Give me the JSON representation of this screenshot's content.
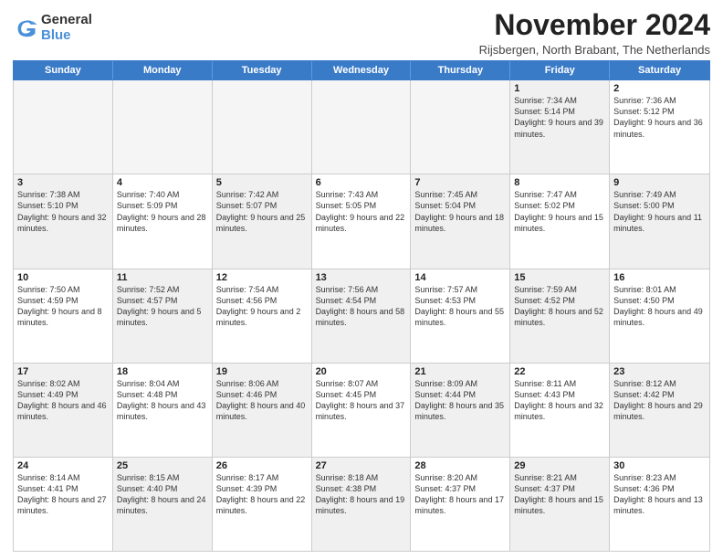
{
  "logo": {
    "general": "General",
    "blue": "Blue"
  },
  "title": "November 2024",
  "location": "Rijsbergen, North Brabant, The Netherlands",
  "days_of_week": [
    "Sunday",
    "Monday",
    "Tuesday",
    "Wednesday",
    "Thursday",
    "Friday",
    "Saturday"
  ],
  "weeks": [
    [
      {
        "day": "",
        "empty": true
      },
      {
        "day": "",
        "empty": true
      },
      {
        "day": "",
        "empty": true
      },
      {
        "day": "",
        "empty": true
      },
      {
        "day": "",
        "empty": true
      },
      {
        "day": "1",
        "info": "Sunrise: 7:34 AM\nSunset: 5:14 PM\nDaylight: 9 hours\nand 39 minutes.",
        "shaded": true
      },
      {
        "day": "2",
        "info": "Sunrise: 7:36 AM\nSunset: 5:12 PM\nDaylight: 9 hours\nand 36 minutes.",
        "shaded": false
      }
    ],
    [
      {
        "day": "3",
        "info": "Sunrise: 7:38 AM\nSunset: 5:10 PM\nDaylight: 9 hours\nand 32 minutes.",
        "shaded": true
      },
      {
        "day": "4",
        "info": "Sunrise: 7:40 AM\nSunset: 5:09 PM\nDaylight: 9 hours\nand 28 minutes.",
        "shaded": false
      },
      {
        "day": "5",
        "info": "Sunrise: 7:42 AM\nSunset: 5:07 PM\nDaylight: 9 hours\nand 25 minutes.",
        "shaded": true
      },
      {
        "day": "6",
        "info": "Sunrise: 7:43 AM\nSunset: 5:05 PM\nDaylight: 9 hours\nand 22 minutes.",
        "shaded": false
      },
      {
        "day": "7",
        "info": "Sunrise: 7:45 AM\nSunset: 5:04 PM\nDaylight: 9 hours\nand 18 minutes.",
        "shaded": true
      },
      {
        "day": "8",
        "info": "Sunrise: 7:47 AM\nSunset: 5:02 PM\nDaylight: 9 hours\nand 15 minutes.",
        "shaded": false
      },
      {
        "day": "9",
        "info": "Sunrise: 7:49 AM\nSunset: 5:00 PM\nDaylight: 9 hours\nand 11 minutes.",
        "shaded": true
      }
    ],
    [
      {
        "day": "10",
        "info": "Sunrise: 7:50 AM\nSunset: 4:59 PM\nDaylight: 9 hours\nand 8 minutes.",
        "shaded": false
      },
      {
        "day": "11",
        "info": "Sunrise: 7:52 AM\nSunset: 4:57 PM\nDaylight: 9 hours\nand 5 minutes.",
        "shaded": true
      },
      {
        "day": "12",
        "info": "Sunrise: 7:54 AM\nSunset: 4:56 PM\nDaylight: 9 hours\nand 2 minutes.",
        "shaded": false
      },
      {
        "day": "13",
        "info": "Sunrise: 7:56 AM\nSunset: 4:54 PM\nDaylight: 8 hours\nand 58 minutes.",
        "shaded": true
      },
      {
        "day": "14",
        "info": "Sunrise: 7:57 AM\nSunset: 4:53 PM\nDaylight: 8 hours\nand 55 minutes.",
        "shaded": false
      },
      {
        "day": "15",
        "info": "Sunrise: 7:59 AM\nSunset: 4:52 PM\nDaylight: 8 hours\nand 52 minutes.",
        "shaded": true
      },
      {
        "day": "16",
        "info": "Sunrise: 8:01 AM\nSunset: 4:50 PM\nDaylight: 8 hours\nand 49 minutes.",
        "shaded": false
      }
    ],
    [
      {
        "day": "17",
        "info": "Sunrise: 8:02 AM\nSunset: 4:49 PM\nDaylight: 8 hours\nand 46 minutes.",
        "shaded": true
      },
      {
        "day": "18",
        "info": "Sunrise: 8:04 AM\nSunset: 4:48 PM\nDaylight: 8 hours\nand 43 minutes.",
        "shaded": false
      },
      {
        "day": "19",
        "info": "Sunrise: 8:06 AM\nSunset: 4:46 PM\nDaylight: 8 hours\nand 40 minutes.",
        "shaded": true
      },
      {
        "day": "20",
        "info": "Sunrise: 8:07 AM\nSunset: 4:45 PM\nDaylight: 8 hours\nand 37 minutes.",
        "shaded": false
      },
      {
        "day": "21",
        "info": "Sunrise: 8:09 AM\nSunset: 4:44 PM\nDaylight: 8 hours\nand 35 minutes.",
        "shaded": true
      },
      {
        "day": "22",
        "info": "Sunrise: 8:11 AM\nSunset: 4:43 PM\nDaylight: 8 hours\nand 32 minutes.",
        "shaded": false
      },
      {
        "day": "23",
        "info": "Sunrise: 8:12 AM\nSunset: 4:42 PM\nDaylight: 8 hours\nand 29 minutes.",
        "shaded": true
      }
    ],
    [
      {
        "day": "24",
        "info": "Sunrise: 8:14 AM\nSunset: 4:41 PM\nDaylight: 8 hours\nand 27 minutes.",
        "shaded": false
      },
      {
        "day": "25",
        "info": "Sunrise: 8:15 AM\nSunset: 4:40 PM\nDaylight: 8 hours\nand 24 minutes.",
        "shaded": true
      },
      {
        "day": "26",
        "info": "Sunrise: 8:17 AM\nSunset: 4:39 PM\nDaylight: 8 hours\nand 22 minutes.",
        "shaded": false
      },
      {
        "day": "27",
        "info": "Sunrise: 8:18 AM\nSunset: 4:38 PM\nDaylight: 8 hours\nand 19 minutes.",
        "shaded": true
      },
      {
        "day": "28",
        "info": "Sunrise: 8:20 AM\nSunset: 4:37 PM\nDaylight: 8 hours\nand 17 minutes.",
        "shaded": false
      },
      {
        "day": "29",
        "info": "Sunrise: 8:21 AM\nSunset: 4:37 PM\nDaylight: 8 hours\nand 15 minutes.",
        "shaded": true
      },
      {
        "day": "30",
        "info": "Sunrise: 8:23 AM\nSunset: 4:36 PM\nDaylight: 8 hours\nand 13 minutes.",
        "shaded": false
      }
    ]
  ]
}
